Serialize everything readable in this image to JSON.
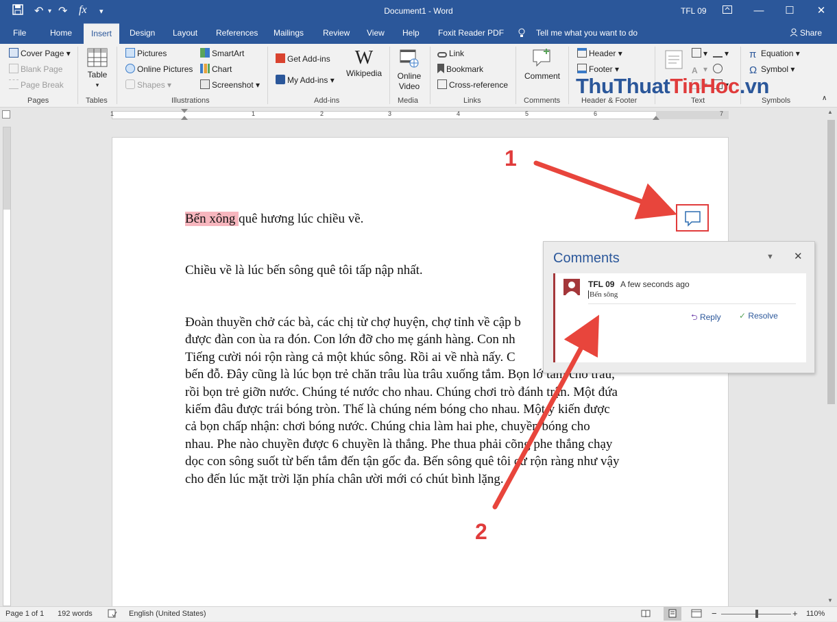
{
  "titlebar": {
    "document_title": "Document1  -  Word",
    "user": "TFL 09"
  },
  "tabs": [
    "File",
    "Home",
    "Insert",
    "Design",
    "Layout",
    "References",
    "Mailings",
    "Review",
    "View",
    "Help",
    "Foxit Reader PDF"
  ],
  "active_tab": "Insert",
  "tell_me": "Tell me what you want to do",
  "share": "Share",
  "ribbon": {
    "pages": {
      "cover_page": "Cover Page",
      "blank_page": "Blank Page",
      "page_break": "Page Break",
      "label": "Pages"
    },
    "tables": {
      "table": "Table",
      "label": "Tables"
    },
    "illustrations": {
      "pictures": "Pictures",
      "online_pictures": "Online Pictures",
      "shapes": "Shapes",
      "smartart": "SmartArt",
      "chart": "Chart",
      "screenshot": "Screenshot",
      "label": "Illustrations"
    },
    "addins": {
      "get_addins": "Get Add-ins",
      "my_addins": "My Add-ins",
      "wikipedia": "Wikipedia",
      "label": "Add-ins"
    },
    "media": {
      "online_video_1": "Online",
      "online_video_2": "Video",
      "label": "Media"
    },
    "links": {
      "link": "Link",
      "bookmark": "Bookmark",
      "cross_reference": "Cross-reference",
      "label": "Links"
    },
    "comments": {
      "comment": "Comment",
      "label": "Comments"
    },
    "header_footer": {
      "header": "Header",
      "footer": "Footer",
      "label": "Header & Footer"
    },
    "text": {
      "label": "Text"
    },
    "symbols": {
      "equation": "Equation",
      "symbol": "Symbol",
      "label": "Symbols"
    }
  },
  "watermark": {
    "part1": "ThuThuat",
    "part2": "TinHoc",
    "part3": ".vn"
  },
  "ruler_numbers": [
    "1",
    "1",
    "2",
    "3",
    "4",
    "5",
    "6",
    "7"
  ],
  "document": {
    "p1_highlight": "Bến xông ",
    "p1_rest": "quê hương lúc chiều về.",
    "p2": "Chiều về là lúc bến sông quê tôi tấp nập nhất.",
    "p3_lines": [
      "Đoàn thuyền chở các bà, các chị từ chợ huyện, chợ tỉnh về cập b",
      "được đàn con ùa ra đón. Con lớn đỡ cho mẹ gánh hàng. Con nh",
      "Tiếng cười nói rộn ràng cả một khúc sông. Rồi ai về nhà nấy. C",
      "bến đỗ. Đây cũng là lúc bọn trẻ chăn trâu lùa trâu xuống tắm. Bọn lớ tắm cho trâu,",
      "rồi bọn trẻ giỡn nước. Chúng té nước cho nhau. Chúng chơi trò đánh trận. Một đứa",
      "kiếm đâu được trái bóng tròn. Thế là chúng ném bóng cho nhau. Một ý kiến được",
      "cả bọn chấp nhận: chơi bóng nước. Chúng chia làm hai phe, chuyền bóng cho",
      "nhau. Phe nào chuyền được 6 chuyền là thắng. Phe thua phải cõng phe thắng chạy",
      "dọc con sông suốt từ bến tắm đến tận gốc đa. Bến sông quê tôi cứ rộn ràng như vậy",
      "cho đến lúc mặt trời lặn phía chân ười mới có chút bình lặng."
    ]
  },
  "comments_pane": {
    "title": "Comments",
    "author": "TFL 09",
    "time": "A few seconds ago",
    "text": "Bến sông",
    "reply": "Reply",
    "resolve": "Resolve"
  },
  "annotations": {
    "n1": "1",
    "n2": "2"
  },
  "statusbar": {
    "page": "Page 1 of 1",
    "words": "192 words",
    "language": "English (United States)",
    "zoom": "110%"
  },
  "colors": {
    "brand": "#2b579a",
    "highlight": "#f7b6be",
    "annotation_red": "#e03b3b"
  }
}
